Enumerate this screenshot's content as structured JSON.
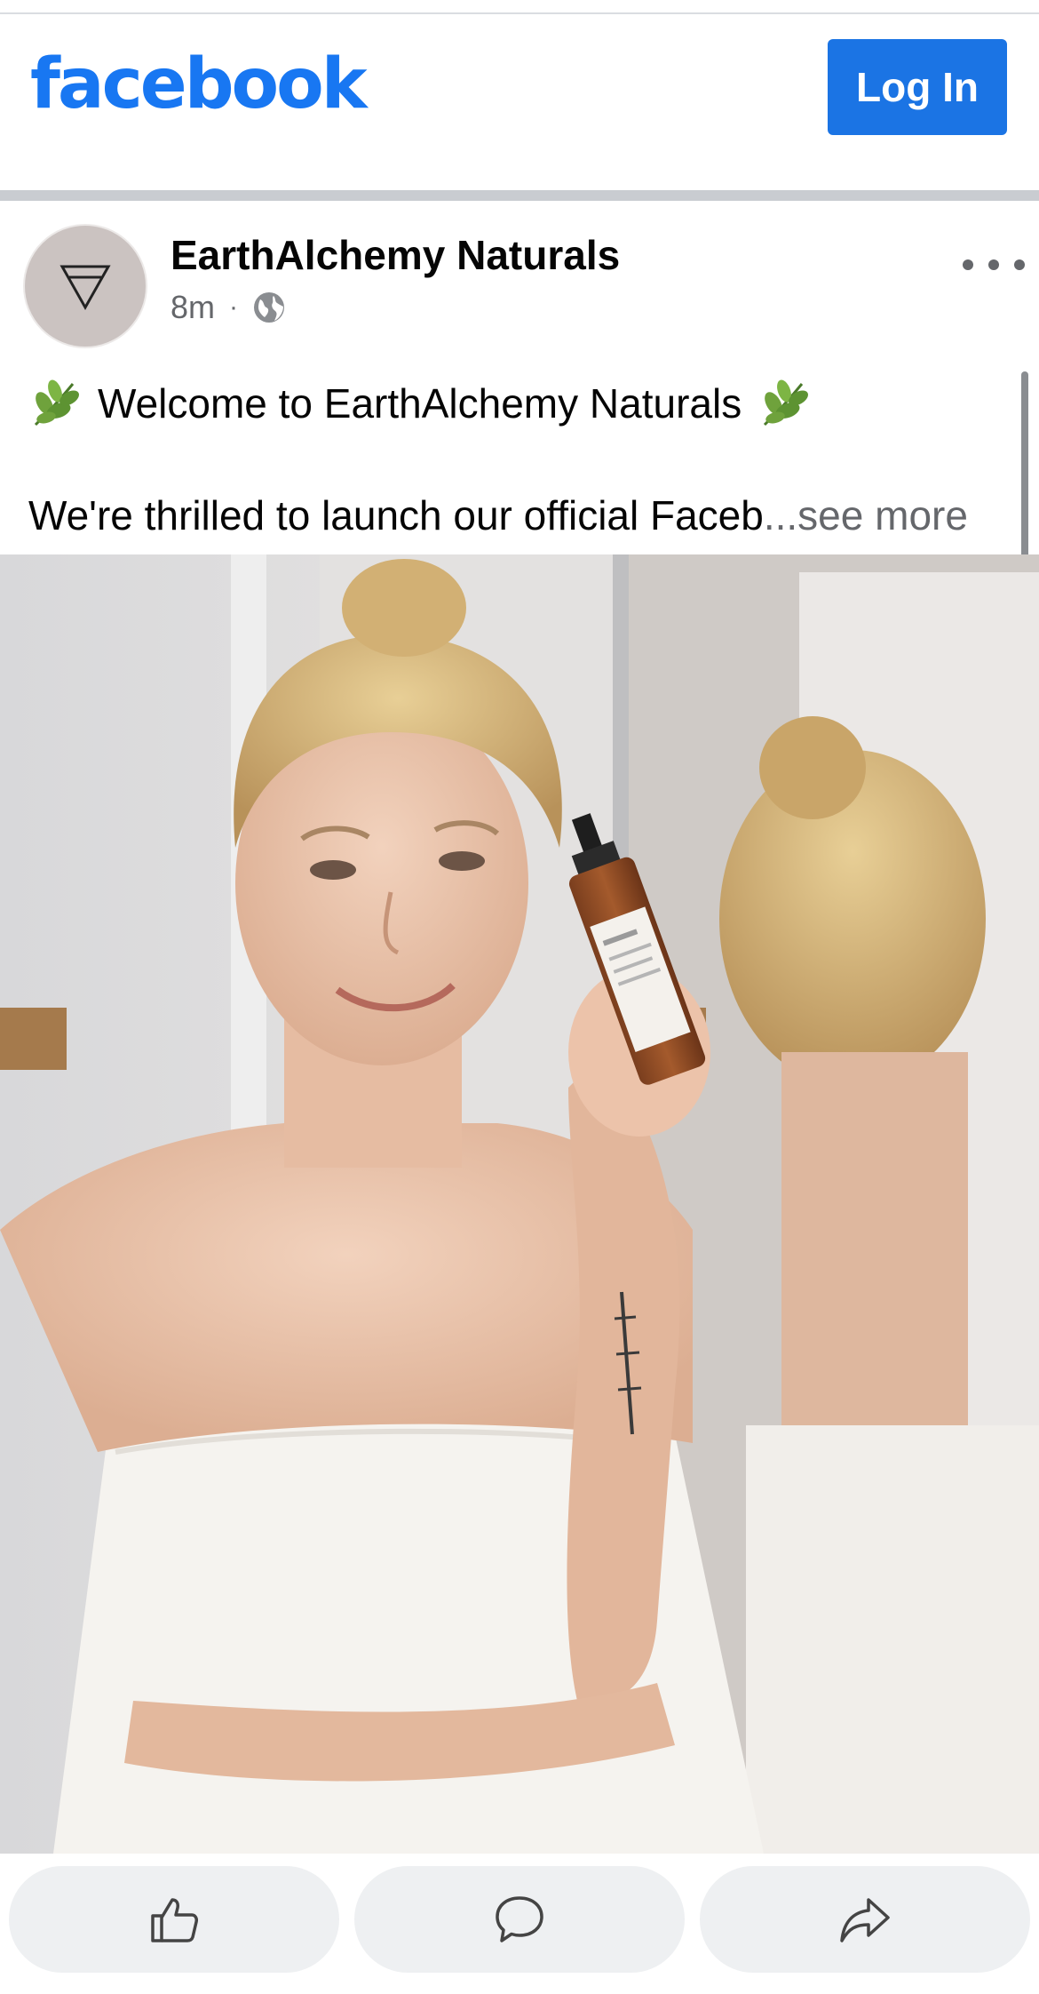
{
  "app": {
    "logo_text": "facebook",
    "brand_color": "#1877f2",
    "login_label": "Log In"
  },
  "post": {
    "author": "EarthAlchemy Naturals",
    "time": "8m",
    "audience_icon": "globe-icon",
    "avatar_icon": "inverted-triangle-icon",
    "line1": "Welcome to EarthAlchemy Naturals",
    "line1_decoration_icon": "leaf-icon",
    "line2": "We're thrilled to launch our official Faceb",
    "see_more": "...see more",
    "photo_description_icon": "product-photo"
  },
  "actions": [
    {
      "icon": "like-icon"
    },
    {
      "icon": "comment-icon"
    },
    {
      "icon": "share-icon"
    }
  ]
}
